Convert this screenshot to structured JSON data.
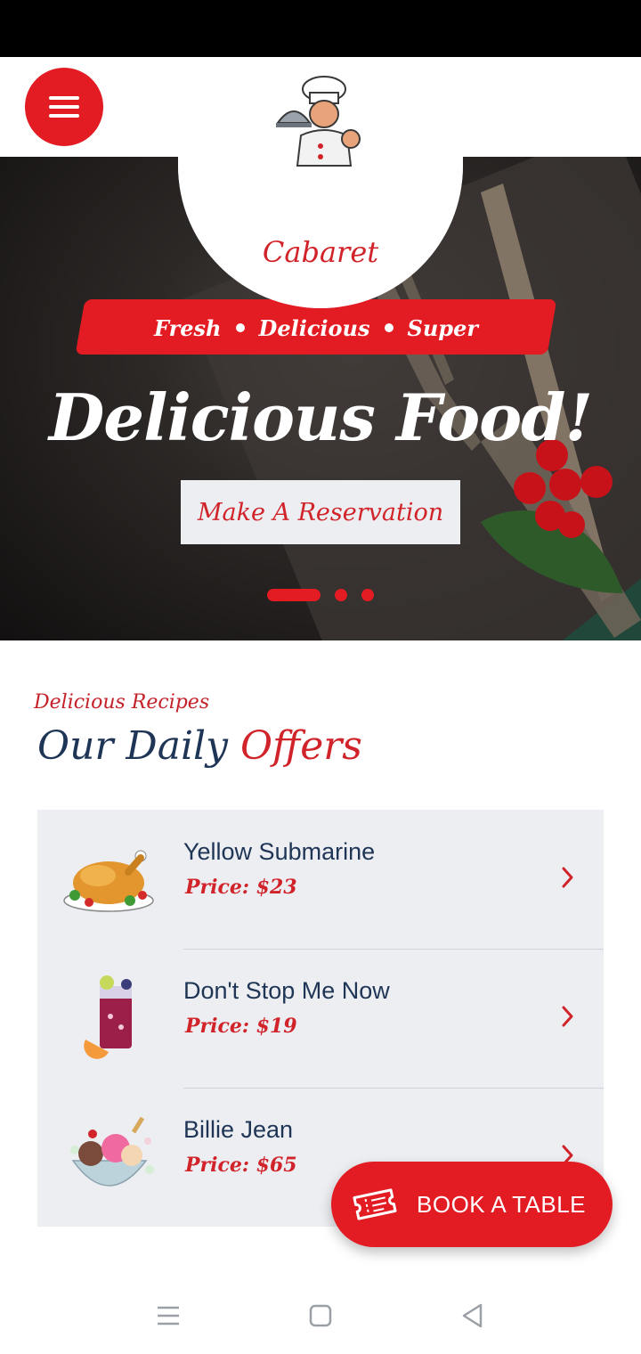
{
  "header": {
    "brand": "Cabaret",
    "menu_icon": "hamburger-icon",
    "logo_icon": "chef-icon"
  },
  "hero": {
    "tagline": [
      "Fresh",
      "Delicious",
      "Super"
    ],
    "title": "Delicious Food!",
    "cta_label": "Make A Reservation",
    "slides": {
      "count": 3,
      "active": 1
    }
  },
  "offers_section": {
    "eyebrow": "Delicious Recipes",
    "title_part1": "Our Daily",
    "title_part2": "Offers",
    "items": [
      {
        "name": "Yellow Submarine",
        "price": "Price: $23",
        "icon": "roast-chicken-icon"
      },
      {
        "name": "Don't Stop Me Now",
        "price": "Price: $19",
        "icon": "drink-icon"
      },
      {
        "name": "Billie Jean",
        "price": "Price: $65",
        "icon": "ice-cream-icon"
      }
    ]
  },
  "floating_action": {
    "label": "BOOK A TABLE",
    "icon": "ticket-icon"
  },
  "system_nav": {
    "items": [
      "menu-icon",
      "home-icon",
      "back-icon"
    ]
  },
  "colors": {
    "accent": "#e31b23",
    "navy": "#1e3555",
    "panel": "#eceef2"
  }
}
